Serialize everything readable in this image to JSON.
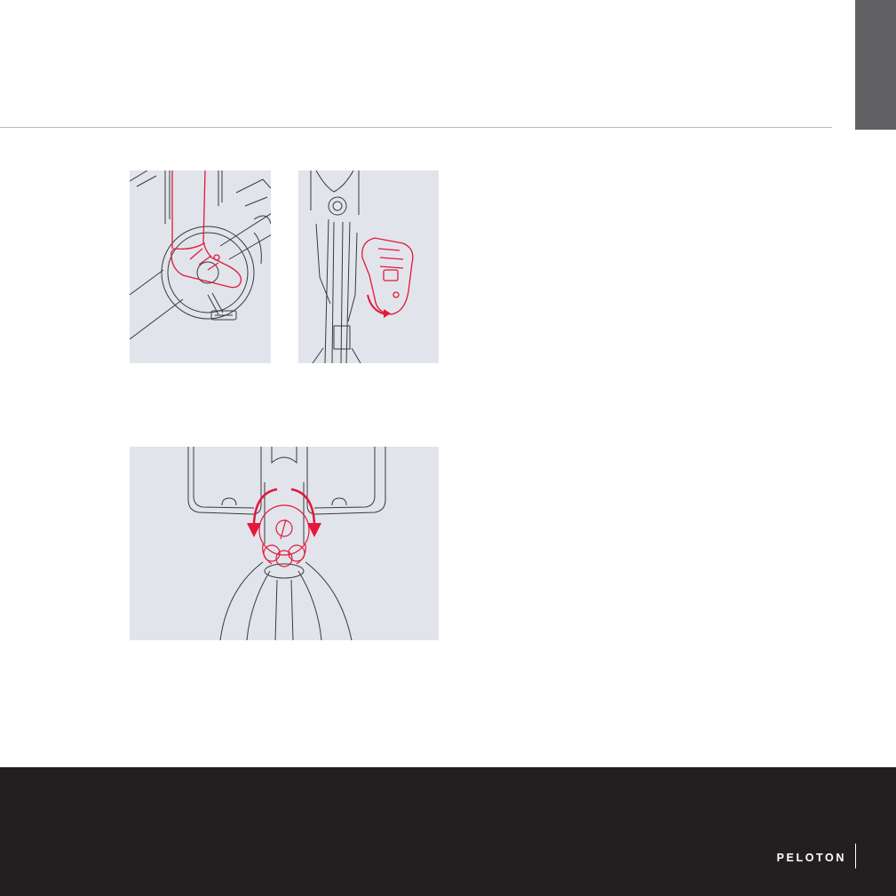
{
  "page": {
    "colors": {
      "side_tab": "#616062",
      "rule": "#bdbcbc",
      "panel_background": "#e2e4ec",
      "line_art": "#3a3a3a",
      "highlight": "#e3183a",
      "footer_background": "#231f20",
      "footer_text": "#ffffff"
    }
  },
  "figures": [
    {
      "name": "clip-in-shoe-illustration",
      "icons": [
        "bike-flywheel",
        "shoe-icon",
        "pedal-icon"
      ]
    },
    {
      "name": "clip-out-shoe-illustration",
      "icons": [
        "bike-frame-top-view",
        "shoe-icon",
        "rotate-outward-arrow-icon"
      ]
    },
    {
      "name": "seat-knob-illustration",
      "icons": [
        "seat-top-view",
        "peloton-logo-knob-icon",
        "counterclockwise-arrow-icon",
        "clockwise-arrow-icon"
      ]
    }
  ],
  "footer": {
    "brand": "PELOTON"
  }
}
